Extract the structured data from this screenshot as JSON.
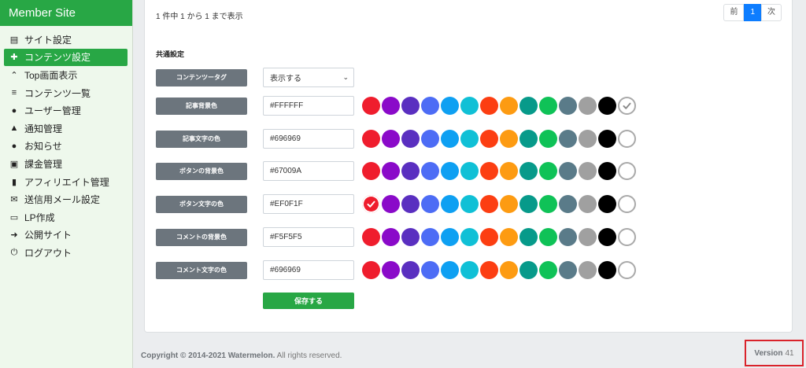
{
  "sidebar": {
    "brand": "Member Site",
    "items": [
      {
        "label": "サイト設定",
        "icon": "card-icon"
      },
      {
        "label": "コンテンツ設定",
        "icon": "folder-plus-icon"
      },
      {
        "label": "Top画面表示",
        "icon": "chevrons-up-icon"
      },
      {
        "label": "コンテンツ一覧",
        "icon": "list-icon"
      },
      {
        "label": "ユーザー管理",
        "icon": "users-icon"
      },
      {
        "label": "通知管理",
        "icon": "bell-icon"
      },
      {
        "label": "お知らせ",
        "icon": "comment-icon"
      },
      {
        "label": "課金管理",
        "icon": "money-icon"
      },
      {
        "label": "アフィリエイト管理",
        "icon": "file-icon"
      },
      {
        "label": "送信用メール設定",
        "icon": "envelope-icon"
      },
      {
        "label": "LP作成",
        "icon": "desktop-icon"
      },
      {
        "label": "公開サイト",
        "icon": "arrow-circle-icon"
      },
      {
        "label": "ログアウト",
        "icon": "power-icon"
      }
    ]
  },
  "main": {
    "count_text": "1 件中 1 から 1 まで表示",
    "pager": {
      "prev": "前",
      "current": "1",
      "next": "次"
    },
    "section_title": "共通設定",
    "tag_row": {
      "label": "コンテンツータグ",
      "value": "表示する"
    },
    "color_rows": [
      {
        "label": "記事背景色",
        "value": "#FFFFFF",
        "checked": 13
      },
      {
        "label": "記事文字の色",
        "value": "#696969",
        "checked": -1
      },
      {
        "label": "ボタンの背景色",
        "value": "#67009A",
        "checked": -1
      },
      {
        "label": "ボタン文字の色",
        "value": "#EF0F1F",
        "checked": 0
      },
      {
        "label": "コメントの背景色",
        "value": "#F5F5F5",
        "checked": -1
      },
      {
        "label": "コメント文字の色",
        "value": "#696969",
        "checked": -1
      }
    ],
    "palette": [
      "#ef1d2d",
      "#8a0ac9",
      "#5a2fc0",
      "#4d6cf5",
      "#0ea0f2",
      "#10c0d6",
      "#fc3e12",
      "#fd9b12",
      "#079a8a",
      "#0fc257",
      "#5a7b89",
      "#a0a0a0",
      "#000000",
      "#ffffff"
    ],
    "save_label": "保存する"
  },
  "footer": {
    "copyright_bold": "Copyright © 2014-2021 Watermelon.",
    "copyright_rest": " All rights reserved.",
    "version_label": "Version",
    "version_number": "41"
  }
}
